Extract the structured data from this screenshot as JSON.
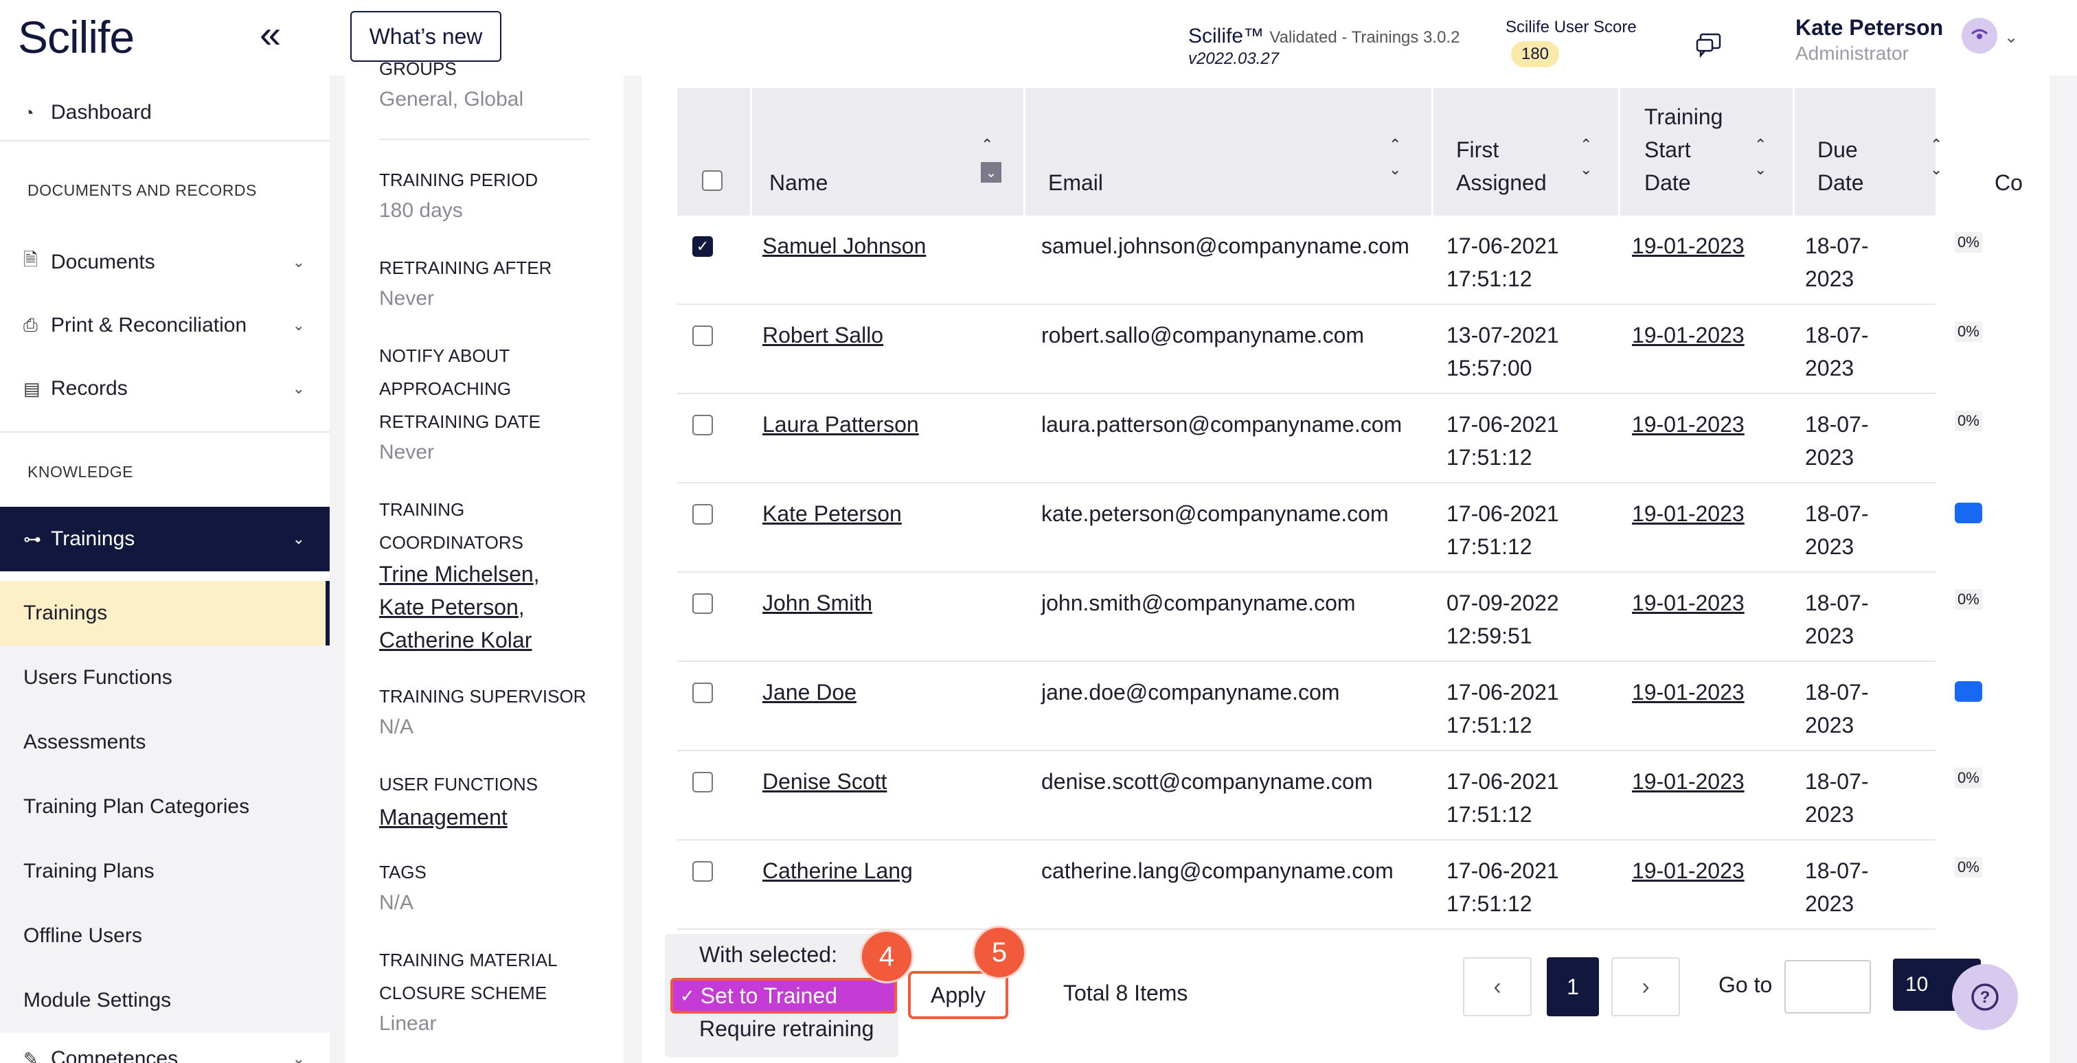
{
  "header": {
    "logo": "Scilife",
    "whats_new": "What’s new",
    "app_name": "Scilife™",
    "app_subtitle": "Validated - Trainings 3.0.2",
    "app_version": "v2022.03.27",
    "score_label": "Scilife User Score",
    "score_value": "180",
    "user_name": "Kate Peterson",
    "user_role": "Administrator"
  },
  "sidebar": {
    "dashboard": "Dashboard",
    "section_docs": "DOCUMENTS AND RECORDS",
    "documents": "Documents",
    "print": "Print & Reconciliation",
    "records": "Records",
    "section_knowledge": "KNOWLEDGE",
    "trainings_group": "Trainings",
    "sub": [
      "Trainings",
      "Users Functions",
      "Assessments",
      "Training Plan Categories",
      "Training Plans",
      "Offline Users",
      "Module Settings"
    ],
    "competences": "Competences"
  },
  "details": {
    "groups_label": "GROUPS",
    "groups_value": "General, Global",
    "period_label": "TRAINING PERIOD",
    "period_value": "180 days",
    "retrain_label": "RETRAINING AFTER",
    "retrain_value": "Never",
    "notify_label_1": "NOTIFY ABOUT",
    "notify_label_2": "APPROACHING",
    "notify_label_3": "RETRAINING DATE",
    "notify_value": "Never",
    "coord_label_1": "TRAINING",
    "coord_label_2": "COORDINATORS",
    "coord_1": "Trine Michelsen",
    "coord_2": "Kate Peterson",
    "coord_3": "Catherine Kolar",
    "supervisor_label": "TRAINING SUPERVISOR",
    "supervisor_value": "N/A",
    "functions_label": "USER FUNCTIONS",
    "functions_value": "Management",
    "tags_label": "TAGS",
    "tags_value": "N/A",
    "material_label_1": "TRAINING MATERIAL",
    "material_label_2": "CLOSURE SCHEME",
    "material_value": "Linear"
  },
  "table": {
    "col_name": "Name",
    "col_email": "Email",
    "col_first_1": "First",
    "col_first_2": "Assigned",
    "col_start_1": "Training",
    "col_start_2": "Start",
    "col_start_3": "Date",
    "col_due_1": "Due",
    "col_due_2": "Date",
    "col_comp": "Co",
    "rows": [
      {
        "name": "Samuel Johnson",
        "email": "samuel.johnson@companyname.com",
        "first_d": "17-06-2021",
        "first_t": "17:51:12",
        "start": "19-01-2023",
        "due_d": "18-07-",
        "due_y": "2023",
        "progress": "0%"
      },
      {
        "name": "Robert Sallo",
        "email": "robert.sallo@companyname.com",
        "first_d": "13-07-2021",
        "first_t": "15:57:00",
        "start": "19-01-2023",
        "due_d": "18-07-",
        "due_y": "2023",
        "progress": "0%"
      },
      {
        "name": "Laura Patterson",
        "email": "laura.patterson@companyname.com",
        "first_d": "17-06-2021",
        "first_t": "17:51:12",
        "start": "19-01-2023",
        "due_d": "18-07-",
        "due_y": "2023",
        "progress": "0%"
      },
      {
        "name": "Kate Peterson",
        "email": "kate.peterson@companyname.com",
        "first_d": "17-06-2021",
        "first_t": "17:51:12",
        "start": "19-01-2023",
        "due_d": "18-07-",
        "due_y": "2023",
        "progress": ""
      },
      {
        "name": "John Smith",
        "email": "john.smith@companyname.com",
        "first_d": "07-09-2022",
        "first_t": "12:59:51",
        "start": "19-01-2023",
        "due_d": "18-07-",
        "due_y": "2023",
        "progress": "0%"
      },
      {
        "name": "Jane Doe",
        "email": "jane.doe@companyname.com",
        "first_d": "17-06-2021",
        "first_t": "17:51:12",
        "start": "19-01-2023",
        "due_d": "18-07-",
        "due_y": "2023",
        "progress": ""
      },
      {
        "name": "Denise Scott",
        "email": "denise.scott@companyname.com",
        "first_d": "17-06-2021",
        "first_t": "17:51:12",
        "start": "19-01-2023",
        "due_d": "18-07-",
        "due_y": "2023",
        "progress": "0%"
      },
      {
        "name": "Catherine Lang",
        "email": "catherine.lang@companyname.com",
        "first_d": "17-06-2021",
        "first_t": "17:51:12",
        "start": "19-01-2023",
        "due_d": "18-07-",
        "due_y": "2023",
        "progress": "0%"
      }
    ]
  },
  "footer": {
    "with_selected": "With selected:",
    "opt_trained": "Set to Trained",
    "opt_retrain": "Require retraining",
    "apply": "Apply",
    "step_4": "4",
    "step_5": "5",
    "total": "Total 8 Items",
    "page": "1",
    "goto": "Go to",
    "page_size": "10"
  }
}
